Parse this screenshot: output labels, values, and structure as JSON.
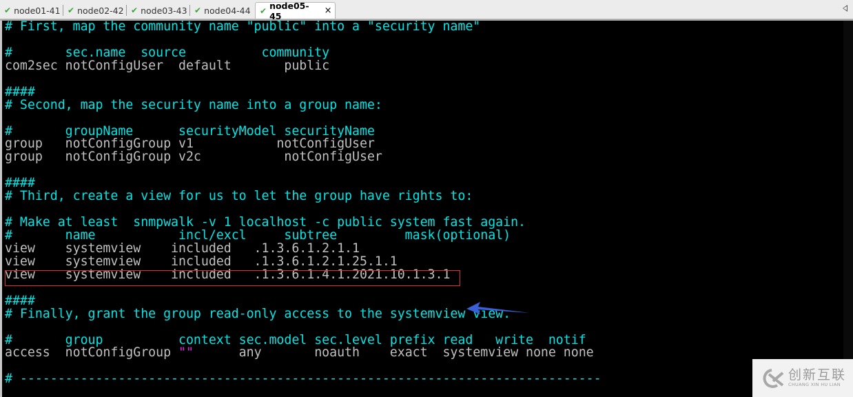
{
  "tabs": [
    {
      "label": "node01-41",
      "status_icon": "check-icon",
      "active": false
    },
    {
      "label": "node02-42",
      "status_icon": "check-icon",
      "active": false
    },
    {
      "label": "node03-43",
      "status_icon": "check-icon",
      "active": false
    },
    {
      "label": "node04-44",
      "status_icon": "check-icon",
      "active": false
    },
    {
      "label": "node05-45",
      "status_icon": "check-icon",
      "active": true,
      "close_glyph": "×"
    }
  ],
  "glyphs": {
    "check": "✔"
  },
  "terminal": {
    "lines": [
      [
        {
          "t": "# First, map the community name \"public\" into a \"security name\"",
          "s": "c"
        }
      ],
      [],
      [
        {
          "t": "#       sec.name  source          community",
          "s": "c"
        }
      ],
      [
        {
          "t": "com2sec notConfigUser  default       public",
          "s": ""
        }
      ],
      [],
      [
        {
          "t": "####",
          "s": "c"
        }
      ],
      [
        {
          "t": "# Second, map the security name into a group name:",
          "s": "c"
        }
      ],
      [],
      [
        {
          "t": "#       groupName      securityModel securityName",
          "s": "c"
        }
      ],
      [
        {
          "t": "group   notConfigGroup v1           notConfigUser",
          "s": ""
        }
      ],
      [
        {
          "t": "group   notConfigGroup v2c           notConfigUser",
          "s": ""
        }
      ],
      [],
      [
        {
          "t": "####",
          "s": "c"
        }
      ],
      [
        {
          "t": "# Third, create a view for us to let the group have rights to:",
          "s": "c"
        }
      ],
      [],
      [
        {
          "t": "# Make at least  snmpwalk -v 1 localhost -c public system fast again.",
          "s": "c"
        }
      ],
      [
        {
          "t": "#       name           incl/excl     subtree         mask(optional)",
          "s": "c"
        }
      ],
      [
        {
          "t": "view    systemview    included   .1.3.6.1.2.1.1",
          "s": ""
        }
      ],
      [
        {
          "t": "view    systemview    included   .1.3.6.1.2.1.25.1.1",
          "s": ""
        }
      ],
      [
        {
          "t": "view    systemview    included   .1.3.6.1.4.1.2021.10.1.3.1",
          "s": ""
        }
      ],
      [],
      [
        {
          "t": "####",
          "s": "c"
        }
      ],
      [
        {
          "t": "# Finally, grant the group read-only access to the systemview view.",
          "s": "c"
        }
      ],
      [],
      [
        {
          "t": "#       group          context sec.model sec.level prefix read   write  notif",
          "s": "c"
        }
      ],
      [
        {
          "t": "access  notConfigGroup ",
          "s": ""
        },
        {
          "t": "\"\"",
          "s": "m"
        },
        {
          "t": "      any       noauth    exact  systemview none none",
          "s": ""
        }
      ],
      [],
      [
        {
          "t": "# -----------------------------------------------------------------------------",
          "s": "c"
        }
      ]
    ],
    "highlighted_line_index": 19,
    "colors": {
      "comment": "#00e5e5",
      "text": "#c0c0c0",
      "string": "#e020e0",
      "highlight_box": "#e03030",
      "arrow": "#3a5fd6"
    }
  },
  "watermark": {
    "cn": "创新互联",
    "en": "CHUANG XIN HU LIAN"
  }
}
